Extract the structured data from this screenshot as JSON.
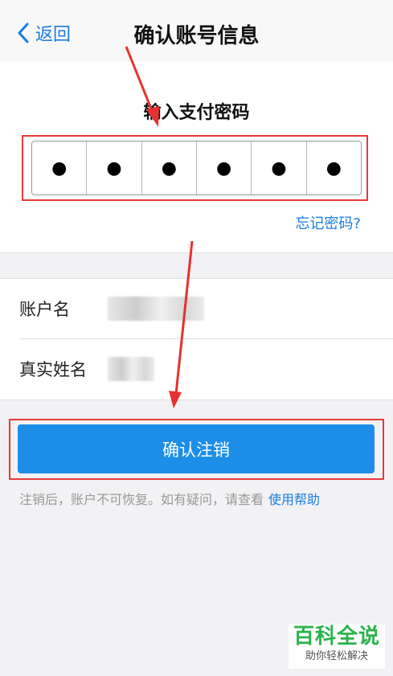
{
  "nav": {
    "back_label": "返回",
    "title": "确认账号信息"
  },
  "password": {
    "title": "输入支付密码",
    "digits": [
      "●",
      "●",
      "●",
      "●",
      "●",
      "●"
    ],
    "forgot_label": "忘记密码?"
  },
  "info": {
    "account_label": "账户名",
    "real_name_label": "真实姓名"
  },
  "confirm_button": "确认注销",
  "note": {
    "text": "注销后，账户不可恢复。如有疑问，请查看",
    "help_link": "使用帮助"
  },
  "watermark": {
    "main": "百科全说",
    "sub": "助你轻松解决"
  },
  "colors": {
    "accent": "#1a7de0",
    "button": "#1c8ee8",
    "highlight": "#e43b3b"
  }
}
